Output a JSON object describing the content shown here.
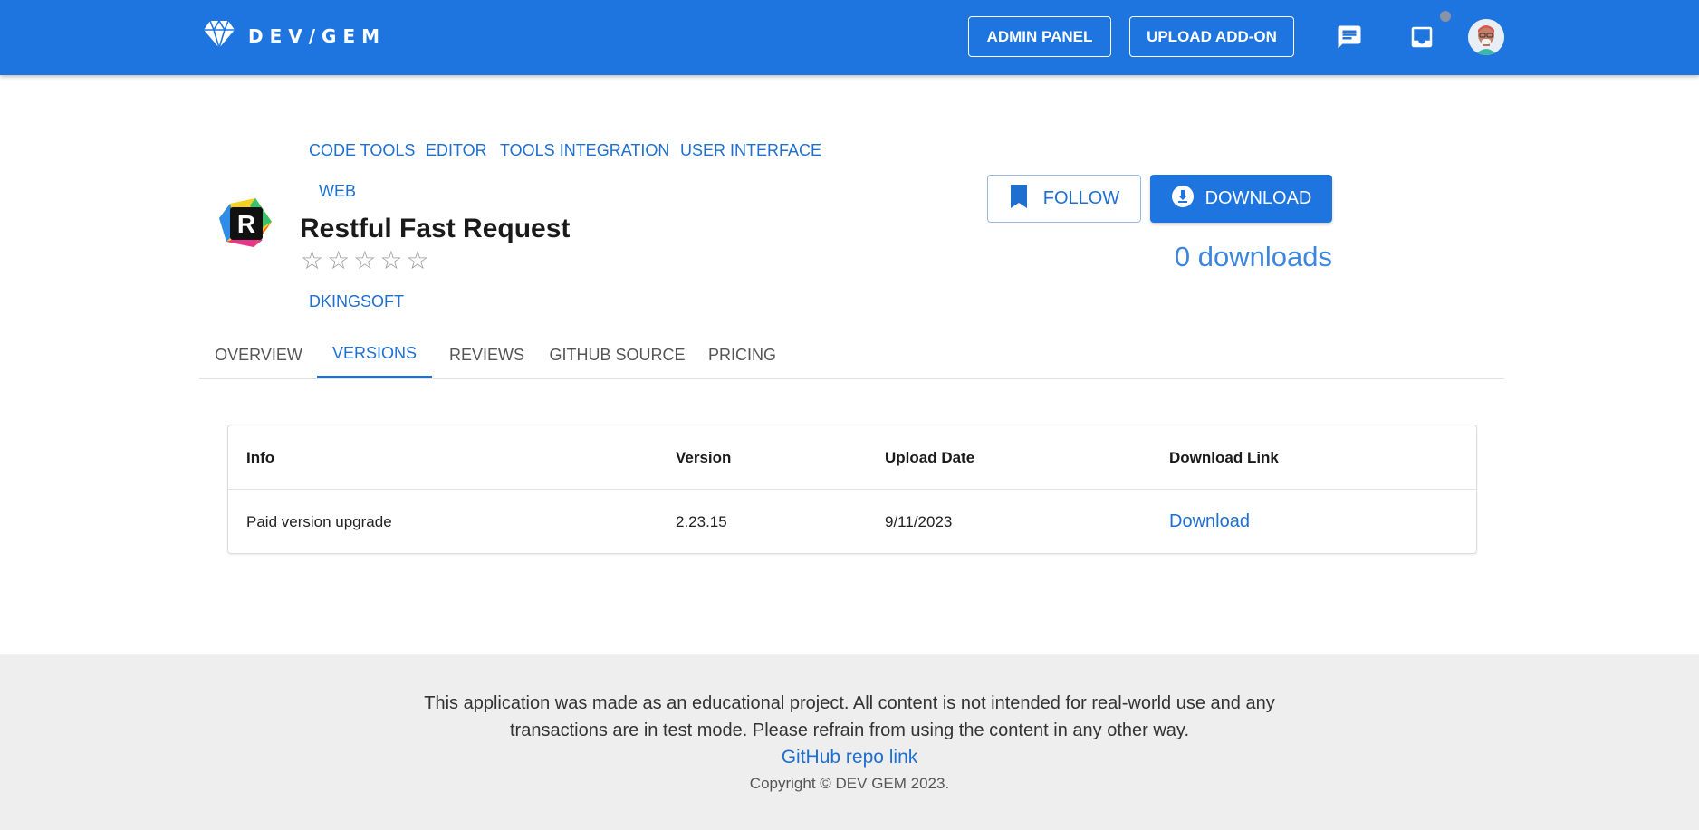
{
  "header": {
    "logo_text": "DEV/GEM",
    "admin_panel_label": "ADMIN PANEL",
    "upload_addon_label": "UPLOAD ADD-ON",
    "brand_color": "#1e75e0",
    "icons": [
      "diamond-icon",
      "chat-icon",
      "inbox-icon",
      "avatar"
    ]
  },
  "addon": {
    "categories": [
      "CODE TOOLS",
      "EDITOR",
      "TOOLS INTEGRATION",
      "USER INTERFACE",
      "WEB"
    ],
    "title": "Restful Fast Request",
    "rating_stars": 0,
    "rating_max": 5,
    "author": "DKINGSOFT",
    "follow_label": "FOLLOW",
    "download_label": "DOWNLOAD",
    "downloads_text": "0 downloads"
  },
  "tabs": [
    {
      "label": "OVERVIEW",
      "active": false
    },
    {
      "label": "VERSIONS",
      "active": true
    },
    {
      "label": "REVIEWS",
      "active": false
    },
    {
      "label": "GITHUB SOURCE",
      "active": false
    },
    {
      "label": "PRICING",
      "active": false
    }
  ],
  "versions_table": {
    "headers": [
      "Info",
      "Version",
      "Upload Date",
      "Download Link"
    ],
    "rows": [
      {
        "info": "Paid version upgrade",
        "version": "2.23.15",
        "upload_date": "9/11/2023",
        "link_label": "Download"
      }
    ]
  },
  "footer": {
    "line1": "This application was made as an educational project. All content is not intended for real-world use and any",
    "line2": "transactions are in test mode. Please refrain from using the content in any other way.",
    "repo_link": "GitHub repo link",
    "copyright": "Copyright © DEV GEM  2023."
  }
}
